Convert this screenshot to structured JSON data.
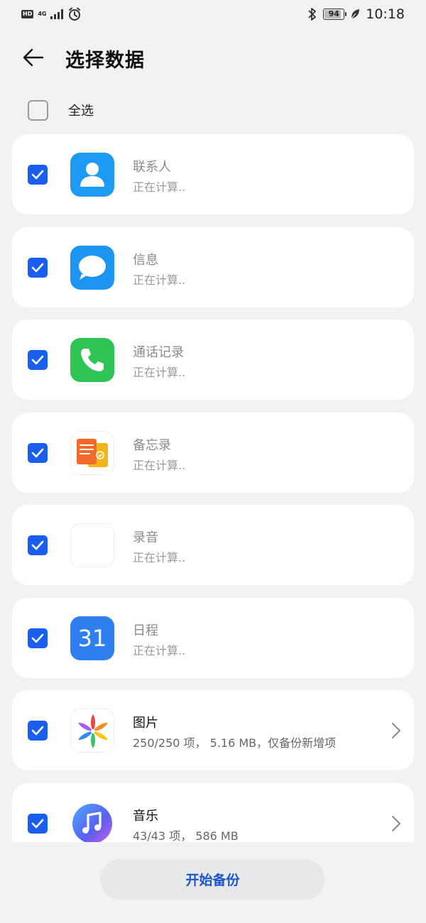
{
  "status_bar": {
    "hd": "HD",
    "network": "4G",
    "battery": "94",
    "battery_level": 0.94,
    "time": "10:18"
  },
  "header": {
    "title": "选择数据"
  },
  "select_all": {
    "label": "全选",
    "checked": false
  },
  "items": [
    {
      "name": "联系人",
      "status": "正在计算..",
      "icon": "contacts-icon",
      "checked": true
    },
    {
      "name": "信息",
      "status": "正在计算..",
      "icon": "messages-icon",
      "checked": true
    },
    {
      "name": "通话记录",
      "status": "正在计算..",
      "icon": "phone-icon",
      "checked": true
    },
    {
      "name": "备忘录",
      "status": "正在计算..",
      "icon": "notes-icon",
      "checked": true
    },
    {
      "name": "录音",
      "status": "正在计算..",
      "icon": "recorder-icon",
      "checked": true
    },
    {
      "name": "日程",
      "status": "正在计算..",
      "icon": "calendar-icon",
      "icon_text": "31",
      "checked": true
    },
    {
      "name": "图片",
      "status": "250/250 项， 5.16 MB，仅备份新增项",
      "icon": "gallery-icon",
      "checked": true
    },
    {
      "name": "音乐",
      "status": "43/43 项， 586 MB",
      "icon": "music-icon",
      "checked": true
    }
  ],
  "footer": {
    "start_label": "开始备份"
  },
  "colors": {
    "accent": "#1a5ef0",
    "background": "#f1f2f4",
    "button_text": "#1a56c8"
  }
}
